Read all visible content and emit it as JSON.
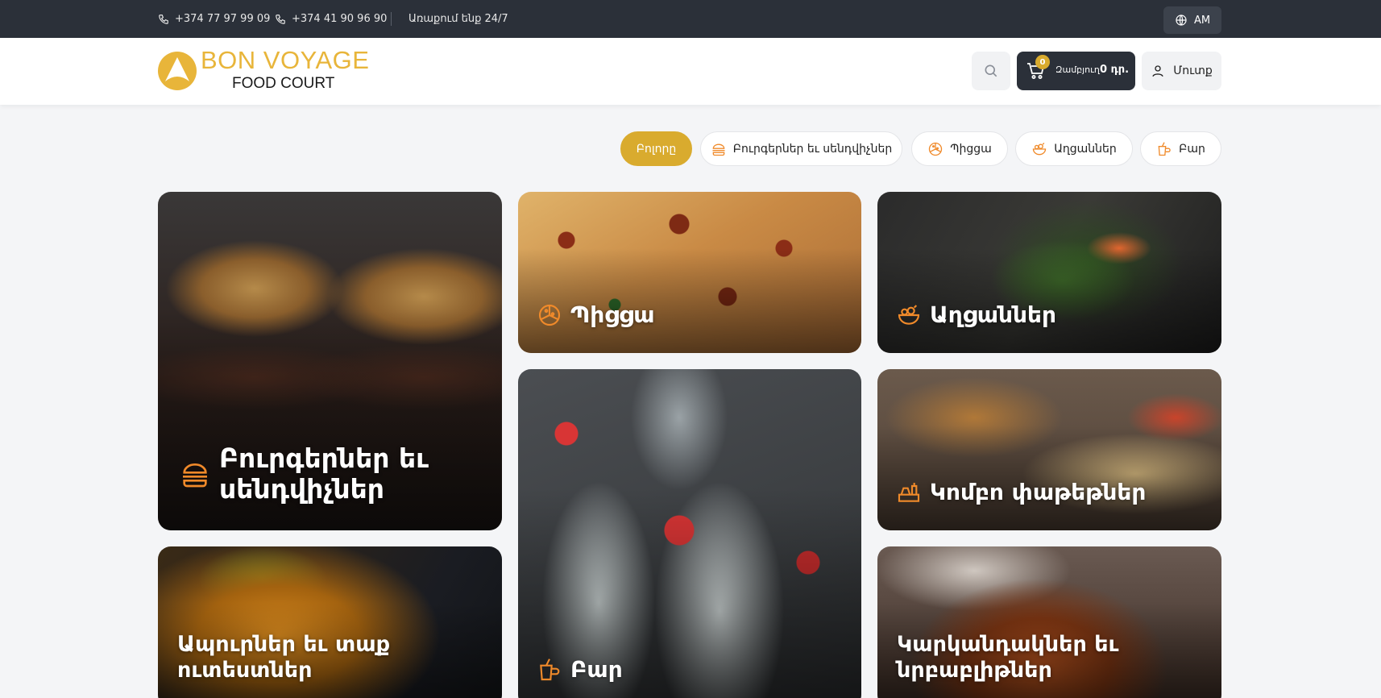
{
  "topbar": {
    "phone1": "+374 77 97 99 09",
    "phone2": "+374 41 90 96 90",
    "hours": "Առաքում ենք 24/7",
    "language": "AM"
  },
  "header": {
    "logo_line1": "BON VOYAGE",
    "logo_line2": "FOOD COURT",
    "cart_count": "0",
    "cart_label": "Զամբյուղ",
    "cart_total": "0 դր.",
    "login_label": "Մուտք"
  },
  "filters": [
    {
      "label": "Բոլորը",
      "icon": "all",
      "active": true
    },
    {
      "label": "Բուրգերներ եւ սենդվիչներ",
      "icon": "burger-icon",
      "active": false
    },
    {
      "label": "Պիցցա",
      "icon": "pizza-icon",
      "active": false
    },
    {
      "label": "Աղցաններ",
      "icon": "salad-icon",
      "active": false
    },
    {
      "label": "Բար",
      "icon": "drinks-icon",
      "active": false
    }
  ],
  "categories": [
    {
      "title": "Բուրգերներ եւ սենդվիչներ",
      "icon": "burger-icon"
    },
    {
      "title": "Պիցցա",
      "icon": "pizza-icon"
    },
    {
      "title": "Աղցաններ",
      "icon": "salad-icon"
    },
    {
      "title": "Բար",
      "icon": "drinks-icon"
    },
    {
      "title": "Կոմբո փաթեթներ",
      "icon": "combo-icon"
    },
    {
      "title": "Ապուրներ եւ տաք ուտեստներ",
      "icon": ""
    },
    {
      "title": "Կարկանդակներ եւ նրբաբլիթներ",
      "icon": ""
    }
  ],
  "colors": {
    "accent": "#d9ab2e",
    "dark": "#2b3039",
    "icon_orange": "#f08a2a"
  }
}
